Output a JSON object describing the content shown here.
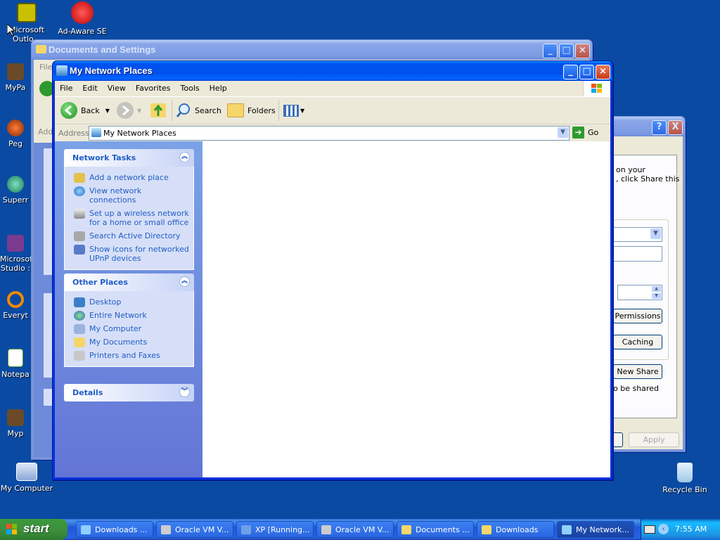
{
  "desktop": {
    "icons": [
      {
        "label": "Microsoft Outlo..."
      },
      {
        "label": "Ad-Aware SE"
      },
      {
        "label": "MyPa"
      },
      {
        "label": "Peg"
      },
      {
        "label": "Superr"
      },
      {
        "label": "Microsoft Studio :"
      },
      {
        "label": "Everyt"
      },
      {
        "label": "Notepa"
      },
      {
        "label": "Myp"
      },
      {
        "label": "My Computer"
      },
      {
        "label": "Recycle Bin"
      }
    ]
  },
  "back_window": {
    "title": "Documents and Settings",
    "menu_stub": "File",
    "address_stub": "Add"
  },
  "back_dialog": {
    "text1": "on your",
    "text2": ", click Share this",
    "permissions_btn": "Permissions",
    "caching_btn": "Caching",
    "newshare_btn": "New Share",
    "shared_text": "o be shared",
    "apply_btn": "Apply",
    "help_glyph": "?",
    "close_glyph": "X"
  },
  "window": {
    "title": "My Network Places",
    "menu": [
      "File",
      "Edit",
      "View",
      "Favorites",
      "Tools",
      "Help"
    ],
    "toolbar": {
      "back": "Back",
      "search": "Search",
      "folders": "Folders"
    },
    "address_label": "Address",
    "address_value": "My Network Places",
    "go_label": "Go",
    "network_tasks": {
      "heading": "Network Tasks",
      "items": [
        "Add a network place",
        "View network connections",
        "Set up a wireless network for a home or small office",
        "Search Active Directory",
        "Show icons for networked UPnP devices"
      ]
    },
    "other_places": {
      "heading": "Other Places",
      "items": [
        "Desktop",
        "Entire Network",
        "My Computer",
        "My Documents",
        "Printers and Faxes"
      ]
    },
    "details": {
      "heading": "Details"
    }
  },
  "taskbar": {
    "start": "start",
    "tasks": [
      "Downloads ...",
      "Oracle VM V...",
      "XP [Running...",
      "Oracle VM V...",
      "Documents ...",
      "Downloads",
      "My Network..."
    ],
    "clock": "7:55 AM"
  },
  "colors": {
    "desktop": "#0a4aa3",
    "task_link": "#215dc6",
    "titlebar": "#0053ee"
  }
}
